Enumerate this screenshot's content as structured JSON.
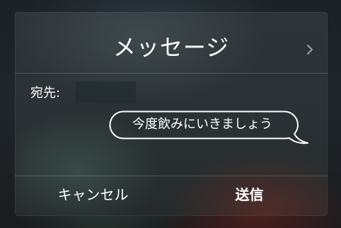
{
  "dialog": {
    "title": "メッセージ",
    "to_label": "宛先:",
    "message": "今度飲みにいきましょう",
    "cancel_label": "キャンセル",
    "send_label": "送信"
  },
  "icons": {
    "forward": "chevron-right-icon"
  }
}
